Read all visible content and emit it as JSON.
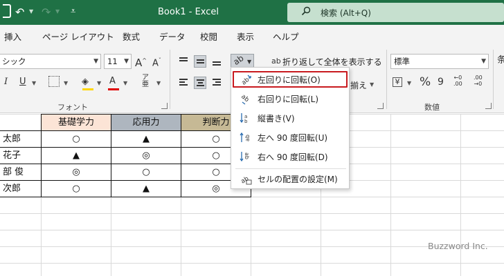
{
  "titlebar": {
    "doc_title": "Book1  -  Excel",
    "search_text": "検索 (Alt+Q)",
    "accent": "#1f7145"
  },
  "menu": {
    "tabs": [
      "挿入",
      "ページ レイアウト",
      "数式",
      "データ",
      "校閲",
      "表示",
      "ヘルプ"
    ]
  },
  "ribbon": {
    "font_name": "シック",
    "font_size": "11",
    "font_group_label": "フォント",
    "wrap_text_label": "折り返して全体を表示する",
    "merge_label": "揃え",
    "number_format": "標準",
    "number_group_label": "数値",
    "percent_symbol": "%"
  },
  "dropdown": {
    "items": [
      {
        "label": "左回りに回転(O)",
        "icon": "rotate-counterclockwise-icon"
      },
      {
        "label": "右回りに回転(L)",
        "icon": "rotate-clockwise-icon"
      },
      {
        "label": "縦書き(V)",
        "icon": "vertical-text-icon"
      },
      {
        "label": "左へ 90 度回転(U)",
        "icon": "rotate-text-up-icon"
      },
      {
        "label": "右へ 90 度回転(D)",
        "icon": "rotate-text-down-icon"
      },
      {
        "label": "セルの配置の設定(M)",
        "icon": "cell-alignment-icon"
      }
    ]
  },
  "sheet": {
    "headers": [
      "基礎学力",
      "応用力",
      "判断力"
    ],
    "header_colors": [
      "#fce4d6",
      "#aeb6bf",
      "#c6b995"
    ],
    "rows": [
      {
        "name": "太郎",
        "values": [
          "○",
          "▲",
          "○"
        ]
      },
      {
        "name": "花子",
        "values": [
          "▲",
          "◎",
          "○"
        ]
      },
      {
        "name": "部 俊",
        "values": [
          "◎",
          "○",
          "○"
        ]
      },
      {
        "name": "次郎",
        "values": [
          "○",
          "▲",
          "◎"
        ]
      }
    ]
  },
  "watermark": "Buzzword Inc."
}
